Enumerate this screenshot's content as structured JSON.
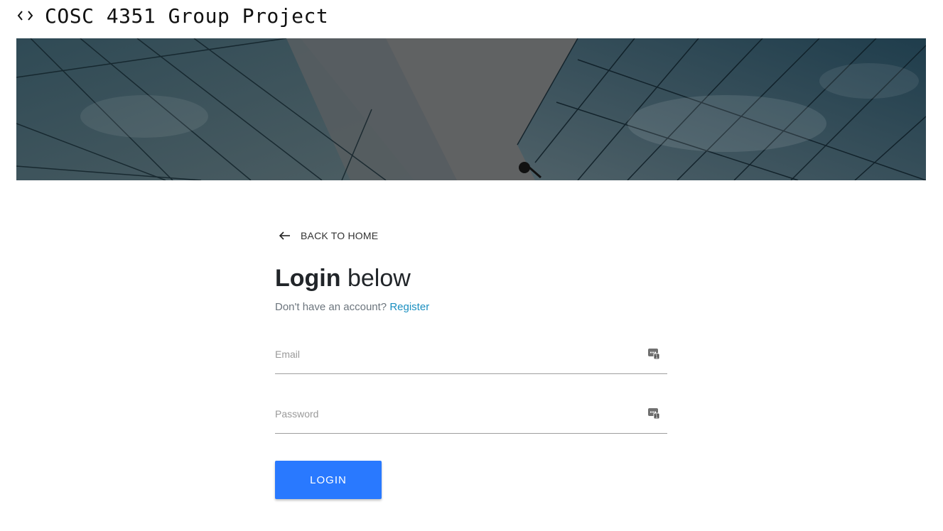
{
  "header": {
    "app_title": "COSC 4351 Group Project",
    "code_icon": "code-brackets-icon"
  },
  "hero": {
    "description_icon": "building-glass-facade-image"
  },
  "login": {
    "back_label": "BACK TO HOME",
    "heading_bold": "Login",
    "heading_light": "below",
    "no_account_text": "Don't have an account?",
    "register_label": "Register",
    "email_placeholder": "Email",
    "password_placeholder": "Password",
    "login_button": "LOGIN"
  },
  "colors": {
    "accent": "#2979ff",
    "link": "#1a8fc0"
  }
}
